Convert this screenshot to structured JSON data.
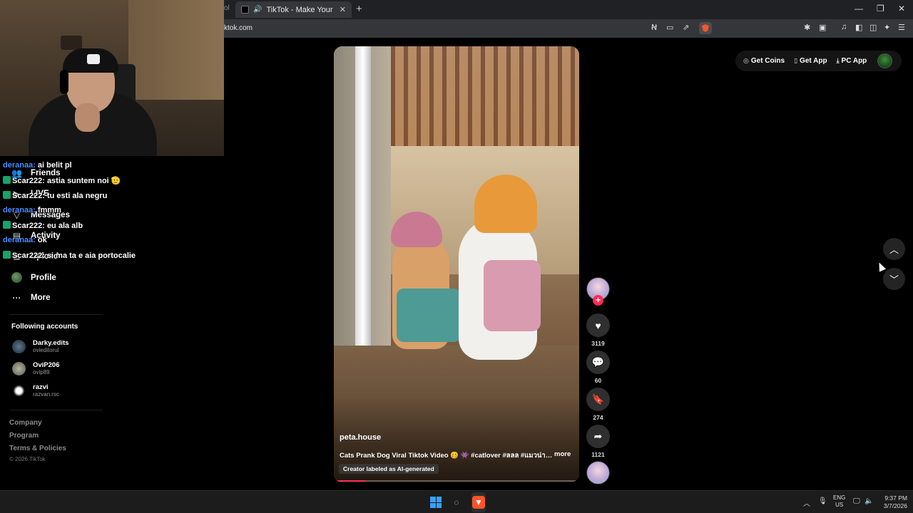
{
  "browser": {
    "prev_tab_fragment": "ol",
    "tab_title": "TikTok - Make Your Day",
    "url": "ktok.com",
    "window_controls": [
      "—",
      "❐",
      "✕"
    ]
  },
  "sidebar": {
    "nav": [
      {
        "label": "Friends",
        "icon": "friends-icon"
      },
      {
        "label": "LIVE",
        "icon": "live-icon"
      },
      {
        "label": "Messages",
        "icon": "messages-icon"
      },
      {
        "label": "Activity",
        "icon": "activity-icon"
      },
      {
        "label": "Upload",
        "icon": "upload-icon"
      },
      {
        "label": "Profile",
        "icon": "profile-avatar"
      },
      {
        "label": "More",
        "icon": "more-icon"
      }
    ],
    "following_title": "Following accounts",
    "following": [
      {
        "name": "Darky.edits",
        "username": "ovieditorul"
      },
      {
        "name": "OviP206",
        "username": "ovip89"
      },
      {
        "name": "razvi",
        "username": "razvan.rsc"
      }
    ],
    "footer": [
      "Company",
      "Program",
      "Terms & Policies"
    ],
    "copyright": "© 2026 TikTok"
  },
  "chat": [
    {
      "user": "deranaa",
      "text": " ai belit pl",
      "badge": false
    },
    {
      "user": "Scar222",
      "text": ": astia suntem noi 🫡",
      "badge": true
    },
    {
      "user": "Scar222",
      "text": ": tu esti ala negru",
      "badge": true
    },
    {
      "user": "deranaa",
      "text": " fmmm",
      "badge": false
    },
    {
      "user": "Scar222",
      "text": ": eu ala alb",
      "badge": true
    },
    {
      "user": "deranaa",
      "text": " ok",
      "badge": false
    },
    {
      "user": "Scar222",
      "text": ": si ma ta e aia portocalie",
      "badge": true
    }
  ],
  "video": {
    "author": "peta.house",
    "caption": "Cats Prank Dog Viral Tiktok Video 🥴 👾 #catlover #ลลล #แมวน่ารัก...",
    "more_label": "more",
    "ai_label": "Creator labeled as AI-generated",
    "progress": 0.12
  },
  "actions": {
    "likes": "3119",
    "comments": "60",
    "saves": "274",
    "shares": "1121"
  },
  "top_right": {
    "coins": "Get Coins",
    "app": "Get App",
    "pc_app": "PC App"
  },
  "taskbar": {
    "lang_top": "ENG",
    "lang_bottom": "US",
    "time": "9:37 PM",
    "date": "3/7/2026"
  },
  "colors": {
    "accent": "#fe2c55",
    "chat_user_blue": "#4a8cff",
    "badge_green": "#17a36a"
  }
}
